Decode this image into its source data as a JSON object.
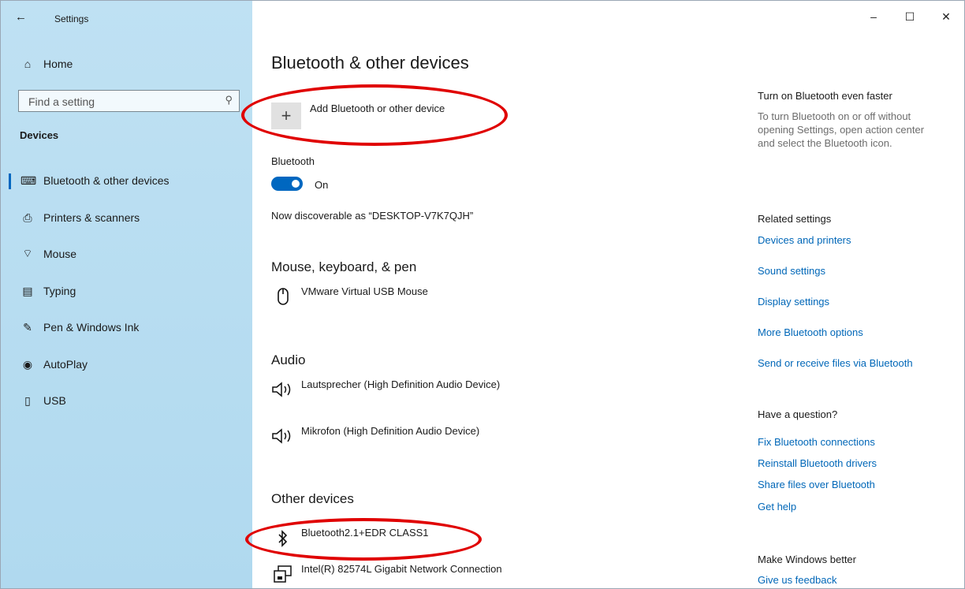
{
  "window": {
    "title": "Settings",
    "back_glyph": "←",
    "minimize_glyph": "–",
    "maximize_glyph": "☐",
    "close_glyph": "✕"
  },
  "sidebar": {
    "home_label": "Home",
    "search_placeholder": "Find a setting",
    "section_title": "Devices",
    "items": [
      {
        "label": "Bluetooth & other devices",
        "icon": "bluetooth-devices-icon",
        "active": true
      },
      {
        "label": "Printers & scanners",
        "icon": "printer-icon"
      },
      {
        "label": "Mouse",
        "icon": "mouse-icon"
      },
      {
        "label": "Typing",
        "icon": "keyboard-icon"
      },
      {
        "label": "Pen & Windows Ink",
        "icon": "pen-icon"
      },
      {
        "label": "AutoPlay",
        "icon": "autoplay-icon"
      },
      {
        "label": "USB",
        "icon": "usb-icon"
      }
    ]
  },
  "main": {
    "title": "Bluetooth & other devices",
    "add_device_label": "Add Bluetooth or other device",
    "bluetooth_label": "Bluetooth",
    "bluetooth_state": "On",
    "discoverable_text": "Now discoverable as “DESKTOP-V7K7QJH”",
    "sections": [
      {
        "title": "Mouse, keyboard, & pen",
        "devices": [
          {
            "name": "VMware Virtual USB Mouse",
            "icon": "mouse-icon"
          }
        ]
      },
      {
        "title": "Audio",
        "devices": [
          {
            "name": "Lautsprecher (High Definition Audio Device)",
            "icon": "speaker-icon"
          },
          {
            "name": "Mikrofon (High Definition Audio Device)",
            "icon": "speaker-icon"
          }
        ]
      },
      {
        "title": "Other devices",
        "devices": [
          {
            "name": "Bluetooth2.1+EDR CLASS1",
            "icon": "bluetooth-icon"
          },
          {
            "name": "Intel(R) 82574L Gigabit Network Connection",
            "icon": "network-adapter-icon"
          }
        ]
      }
    ]
  },
  "right": {
    "faster_title": "Turn on Bluetooth even faster",
    "faster_text": "To turn Bluetooth on or off without opening Settings, open action center and select the Bluetooth icon.",
    "related_title": "Related settings",
    "related_links": [
      "Devices and printers",
      "Sound settings",
      "Display settings",
      "More Bluetooth options",
      "Send or receive files via Bluetooth"
    ],
    "question_title": "Have a question?",
    "question_links": [
      "Fix Bluetooth connections",
      "Reinstall Bluetooth drivers",
      "Share files over Bluetooth",
      "Get help"
    ],
    "better_title": "Make Windows better",
    "feedback_link": "Give us feedback"
  },
  "colors": {
    "accent": "#0067c0",
    "link": "#0067b8",
    "sidebar_bg": "#b8ddf1",
    "annotation": "#e00000"
  }
}
